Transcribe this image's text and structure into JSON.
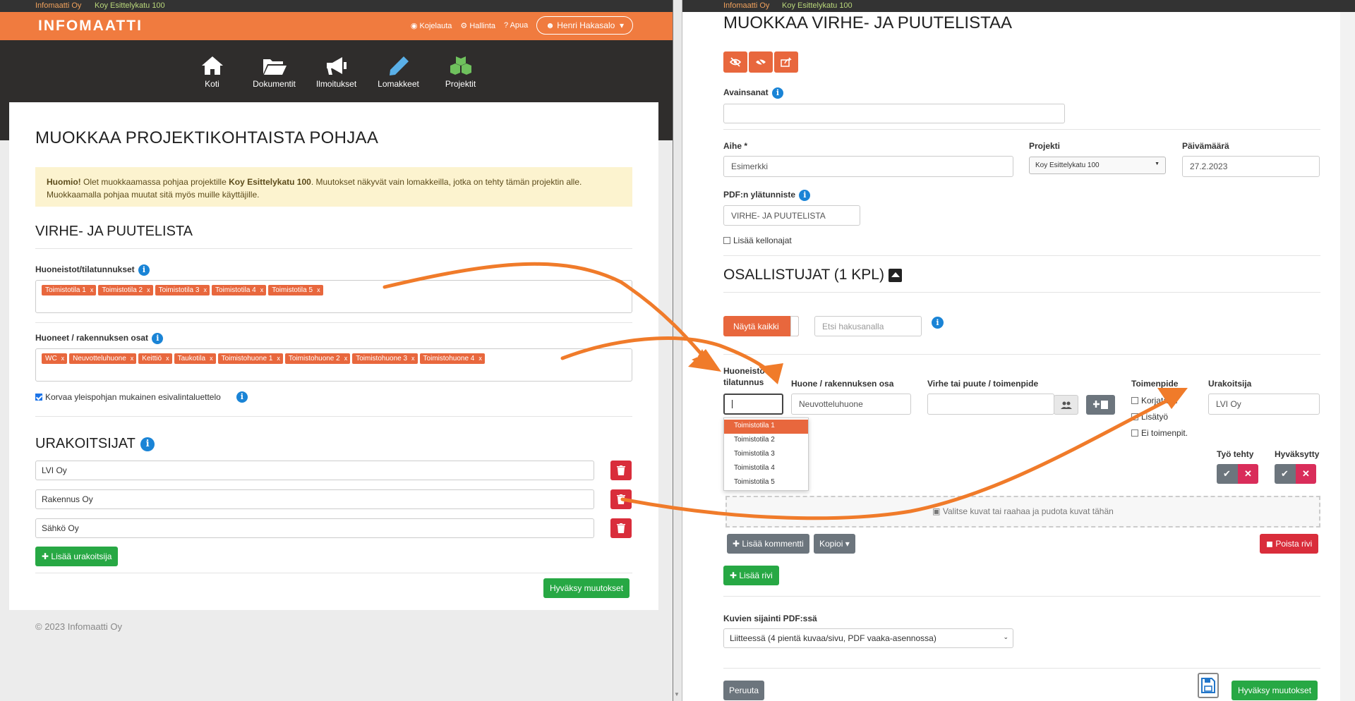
{
  "colors": {
    "accent": "#f07b3f",
    "tag": "#e8673d",
    "success": "#27a844",
    "danger": "#d92d3b",
    "info": "#1a84d6",
    "dark": "#2f2d2c"
  },
  "left": {
    "topstrip": {
      "org": "Infomaatti Oy",
      "project": "Koy Esittelykatu 100"
    },
    "header": {
      "logo": "INFOMAATTI",
      "links": [
        "Kojelauta",
        "Hallinta",
        "Apua"
      ],
      "user": "Henri Hakasalo"
    },
    "iconnav": [
      {
        "label": "Koti",
        "icon": "home-icon"
      },
      {
        "label": "Dokumentit",
        "icon": "folder-icon"
      },
      {
        "label": "Ilmoitukset",
        "icon": "megaphone-icon"
      },
      {
        "label": "Lomakkeet",
        "icon": "pencil-icon"
      },
      {
        "label": "Projektit",
        "icon": "cubes-icon"
      }
    ],
    "title": "MUOKKAA PROJEKTIKOHTAISTA POHJAA",
    "warning": {
      "strong": "Huomio!",
      "text1": " Olet muokkaamassa pohjaa projektille ",
      "project": "Koy Esittelykatu 100",
      "text2": ". Muutokset näkyvät vain lomakkeilla, jotka on tehty tämän projektin alle.",
      "line2": "Muokkaamalla pohjaa muutat sitä myös muille käyttäjille."
    },
    "section_title": "VIRHE- JA PUUTELISTA",
    "units_label": "Huoneistot/tilatunnukset",
    "units": [
      "Toimistotila 1",
      "Toimistotila 2",
      "Toimistotila 3",
      "Toimistotila 4",
      "Toimistotila 5"
    ],
    "rooms_label": "Huoneet / rakennuksen osat",
    "rooms": [
      "WC",
      "Neuvotteluhuone",
      "Keittiö",
      "Taukotila",
      "Toimistohuone 1",
      "Toimistohuone 2",
      "Toimistohuone 3",
      "Toimistohuone 4"
    ],
    "replace_label": "Korvaa yleispohjan mukainen esivalintaluettelo",
    "contractors_title": "URAKOITSIJAT",
    "contractors": [
      "LVI Oy",
      "Rakennus Oy",
      "Sähkö Oy"
    ],
    "add_contractor": "Lisää urakoitsija",
    "accept": "Hyväksy muutokset",
    "footer": "© 2023 Infomaatti Oy"
  },
  "right": {
    "topstrip": {
      "org": "Infomaatti Oy",
      "project": "Koy Esittelykatu 100"
    },
    "title": "MUOKKAA VIRHE- JA PUUTELISTAA",
    "keywords_label": "Avainsanat",
    "subject_label": "Aihe *",
    "subject_value": "Esimerkki",
    "project_label": "Projekti",
    "project_value": "Koy Esittelykatu 100",
    "date_label": "Päivämäärä",
    "date_value": "27.2.2023",
    "pdf_header_label": "PDF:n ylätunniste",
    "pdf_header_value": "VIRHE- JA PUUTELISTA",
    "add_clock_label": "Lisää kellonajat",
    "participants_title": "OSALLISTUJAT (1 KPL)",
    "show_all": "Näytä kaikki",
    "search_placeholder": "Etsi hakusanalla",
    "col_unit_1": "Huoneisto /",
    "col_unit_2": "tilatunnus",
    "col_room": "Huone / rakennuksen osa",
    "col_defect": "Virhe tai puute / toimenpide",
    "col_action": "Toimenpide",
    "col_contractor": "Urakoitsija",
    "room_value": "Neuvotteluhuone",
    "contractor_value": "LVI Oy",
    "action_options": [
      "Korjataan",
      "Lisätyö",
      "Ei toimenpit."
    ],
    "dropdown_options": [
      "Toimistotila 1",
      "Toimistotila 2",
      "Toimistotila 3",
      "Toimistotila 4",
      "Toimistotila 5"
    ],
    "work_done": "Työ tehty",
    "approved": "Hyväksytty",
    "dropzone": "Valitse kuvat tai raahaa ja pudota kuvat tähän",
    "add_comment": "Lisää kommentti",
    "copy": "Kopioi",
    "delete_row": "Poista rivi",
    "add_row": "Lisää rivi",
    "images_label": "Kuvien sijainti PDF:ssä",
    "images_value": "Liitteessä (4 pientä kuvaa/sivu, PDF vaaka-asennossa)",
    "cancel": "Peruuta",
    "accept": "Hyväksy muutokset"
  }
}
